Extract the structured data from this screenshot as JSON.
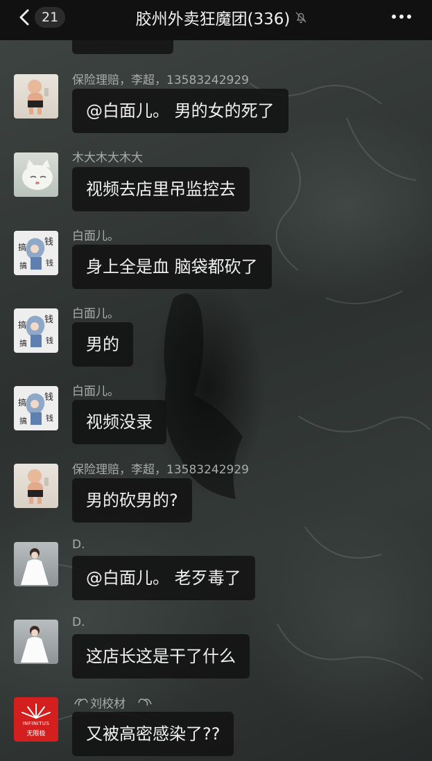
{
  "header": {
    "back_badge": "21",
    "title": "胶州外卖狂魔团(336)",
    "back_icon": "chevron-left-icon",
    "mute_icon": "bell-off-icon",
    "more_icon": "more-dots-icon"
  },
  "messages": [
    {
      "sender": "保险理赔，李超，13583242929",
      "avatar": "baby-avatar",
      "text": "@白面儿。 男的女的死了"
    },
    {
      "sender": "木大木大木大",
      "avatar": "cat-avatar",
      "text": "视频去店里吊监控去"
    },
    {
      "sender": "白面儿。",
      "avatar": "money-avatar",
      "text": "身上全是血   脑袋都砍了"
    },
    {
      "sender": "白面儿。",
      "avatar": "money-avatar",
      "text": "男的"
    },
    {
      "sender": "白面儿。",
      "avatar": "money-avatar",
      "text": "视频没录"
    },
    {
      "sender": "保险理赔，李超，13583242929",
      "avatar": "baby-avatar",
      "text": "男的砍男的?"
    },
    {
      "sender": "D.",
      "avatar": "bride-avatar",
      "text": "@白面儿。 老歹毒了"
    },
    {
      "sender": "D.",
      "avatar": "bride-avatar",
      "text": "这店长这是干了什么"
    },
    {
      "sender": "刘校材",
      "avatar": "infinitus-avatar",
      "text": "又被高密感染了??"
    }
  ],
  "infinitus_logo": {
    "line1": "INFINITUS",
    "line2": "无限极"
  }
}
